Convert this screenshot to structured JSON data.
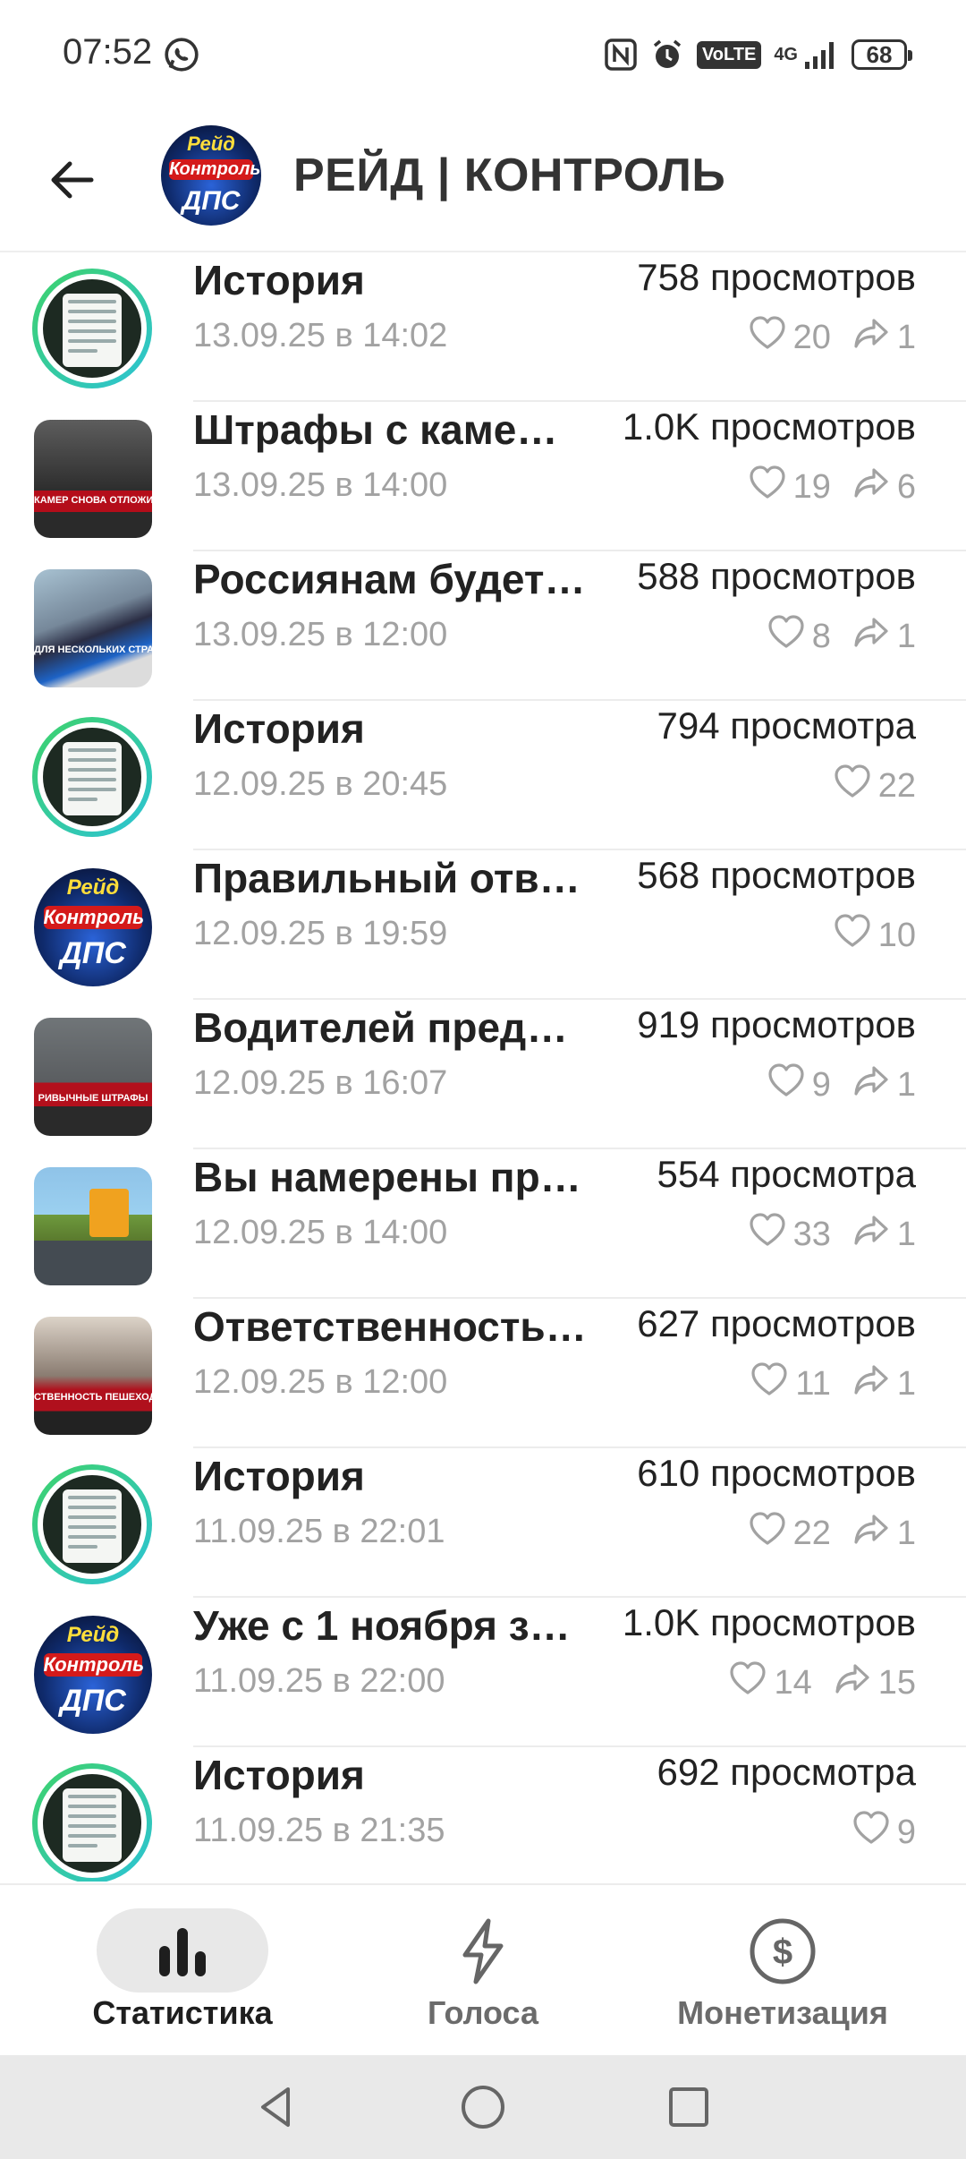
{
  "status_bar": {
    "time": "07:52",
    "battery": "68",
    "network": "4G",
    "volte": "VoLTE"
  },
  "header": {
    "title": "РЕЙД | КОНТРОЛЬ",
    "avatar_top": "Рейд",
    "avatar_mid": "Контроль",
    "avatar_bottom": "ДПС"
  },
  "posts": [
    {
      "title": "История",
      "date": "13.09.25 в 14:02",
      "views": "758 просмотров",
      "likes": "20",
      "shares": "1",
      "thumb": "story"
    },
    {
      "title": "Штрафы с каме…",
      "date": "13.09.25 в 14:00",
      "views": "1.0K просмотров",
      "likes": "19",
      "shares": "6",
      "thumb": "road",
      "caption": "КАМЕР СНОВА ОТЛОЖИЛИ"
    },
    {
      "title": "Россиянам будет…",
      "date": "13.09.25 в 12:00",
      "views": "588 просмотров",
      "likes": "8",
      "shares": "1",
      "thumb": "license",
      "caption": "ДЛЯ НЕСКОЛЬКИХ СТРАН"
    },
    {
      "title": "История",
      "date": "12.09.25 в 20:45",
      "views": "794 просмотра",
      "likes": "22",
      "shares": null,
      "thumb": "story"
    },
    {
      "title": "Правильный отв…",
      "date": "12.09.25 в 19:59",
      "views": "568 просмотров",
      "likes": "10",
      "shares": null,
      "thumb": "dps"
    },
    {
      "title": "Водителей преду…",
      "date": "12.09.25 в 16:07",
      "views": "919 просмотров",
      "likes": "9",
      "shares": "1",
      "thumb": "cars",
      "caption": "РИВЫЧНЫЕ ШТРАФЫ"
    },
    {
      "title": "Вы намерены про…",
      "date": "12.09.25 в 14:00",
      "views": "554 просмотра",
      "likes": "33",
      "shares": "1",
      "thumb": "bus"
    },
    {
      "title": "Ответственность…",
      "date": "12.09.25 в 12:00",
      "views": "627 просмотров",
      "likes": "11",
      "shares": "1",
      "thumb": "ped",
      "caption": "СТВЕННОСТЬ ПЕШЕХОДОВ"
    },
    {
      "title": "История",
      "date": "11.09.25 в 22:01",
      "views": "610 просмотров",
      "likes": "22",
      "shares": "1",
      "thumb": "story"
    },
    {
      "title": "Уже с 1 ноября з…",
      "date": "11.09.25 в 22:00",
      "views": "1.0K просмотров",
      "likes": "14",
      "shares": "15",
      "thumb": "dps"
    },
    {
      "title": "История",
      "date": "11.09.25 в 21:35",
      "views": "692 просмотра",
      "likes": "9",
      "shares": null,
      "thumb": "story"
    }
  ],
  "bottom_nav": [
    {
      "label": "Статистика",
      "icon": "bar-chart-icon",
      "active": true
    },
    {
      "label": "Голоса",
      "icon": "lightning-icon",
      "active": false
    },
    {
      "label": "Монетизация",
      "icon": "dollar-circle-icon",
      "active": false
    }
  ],
  "colors": {
    "accent_pill": "#e8e8e8",
    "story_ring_start": "#3ed26a",
    "story_ring_end": "#2cc3d6",
    "muted_text": "#a2a2a2"
  }
}
